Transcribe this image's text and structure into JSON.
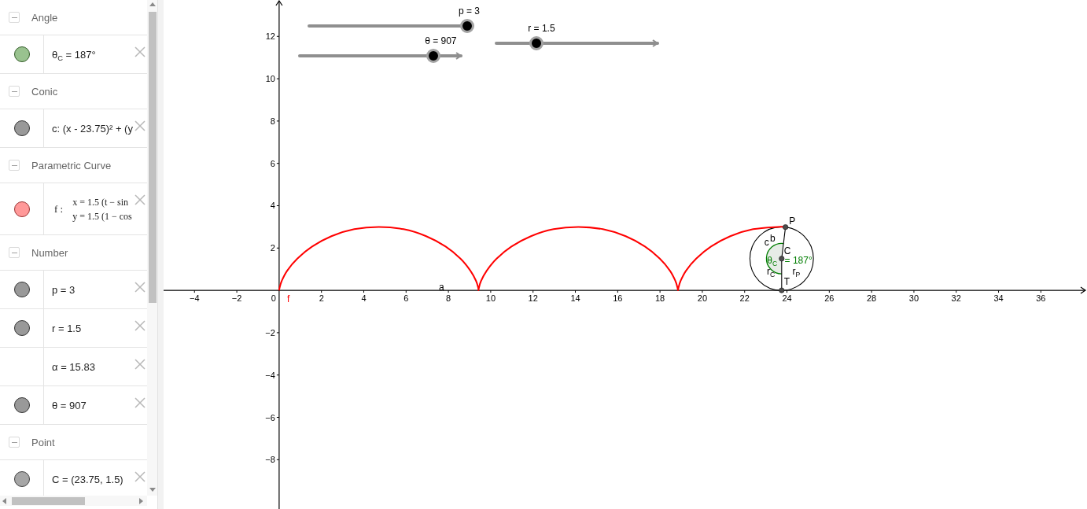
{
  "algebra": {
    "groups": [
      {
        "title": "Angle",
        "expanded": true,
        "items": [
          {
            "kind": "text",
            "color": "#99c28f",
            "text": "θ$_{C}$ = 187°"
          }
        ]
      },
      {
        "title": "Conic",
        "expanded": true,
        "items": [
          {
            "kind": "text",
            "color": "#999999",
            "text": "c: (x - 23.75)² + (y"
          }
        ]
      },
      {
        "title": "Parametric Curve",
        "expanded": true,
        "items": [
          {
            "kind": "parametric",
            "color": "#ff9999",
            "name": "f :",
            "lines": [
              "x = 1.5 (t − sin",
              "y = 1.5 (1 − cos"
            ]
          }
        ]
      },
      {
        "title": "Number",
        "expanded": true,
        "items": [
          {
            "kind": "text",
            "color": "#999999",
            "text": "p = 3"
          },
          {
            "kind": "text",
            "color": "#999999",
            "text": "r = 1.5"
          },
          {
            "kind": "text",
            "text": "α = 15.83"
          },
          {
            "kind": "text",
            "color": "#999999",
            "text": "θ = 907"
          }
        ]
      },
      {
        "title": "Point",
        "expanded": true,
        "items": [
          {
            "kind": "text",
            "color": "#a6a6a6",
            "text": "C = (23.75, 1.5)"
          }
        ]
      }
    ]
  },
  "graphics": {
    "origin_label": "0",
    "sliders": [
      {
        "label": "p = 3",
        "level": 0.98
      },
      {
        "label": "θ = 907",
        "level": 0.83
      },
      {
        "label": "r = 1.5",
        "level": 0.25
      }
    ],
    "labels": [
      {
        "text": "P"
      },
      {
        "text": "C"
      },
      {
        "text": "T"
      },
      {
        "text": "b"
      },
      {
        "text": "c"
      },
      {
        "text": "θ$_{C}$",
        "color": "#007d00"
      },
      {
        "text": "= 187°",
        "color": "#007d00"
      },
      {
        "text": "r$_{C}$"
      },
      {
        "text": "r$_{P}$"
      },
      {
        "text": "a"
      }
    ],
    "chart_data": {
      "type": "line",
      "x": [
        0,
        0.02,
        0.12,
        0.38,
        0.86,
        1.56,
        2.47,
        3.55,
        4.71,
        5.88,
        6.95,
        7.87,
        8.57,
        9.04,
        9.31,
        9.41,
        9.42,
        9.44,
        9.54,
        9.81,
        10.28,
        10.98,
        11.9,
        12.97,
        14.14,
        15.3,
        16.38,
        17.29,
        17.99,
        18.47,
        18.73,
        18.83,
        18.85,
        18.87,
        18.97,
        19.23,
        19.71,
        20.41,
        21.32,
        22.4,
        23.56,
        23.93
      ],
      "series": [
        {
          "name": "f",
          "color": "#ff0000",
          "values": [
            0,
            0.11,
            0.44,
            0.93,
            1.5,
            2.07,
            2.56,
            2.89,
            3,
            2.89,
            2.56,
            2.07,
            1.5,
            0.93,
            0.44,
            0.11,
            0,
            0.11,
            0.44,
            0.93,
            1.5,
            2.07,
            2.56,
            2.89,
            3,
            2.89,
            2.56,
            2.07,
            1.5,
            0.93,
            0.44,
            0.11,
            0,
            0.11,
            0.44,
            0.93,
            1.5,
            2.07,
            2.56,
            2.89,
            3,
            2.99
          ]
        }
      ],
      "xlim": [
        -5.46,
        38.18
      ],
      "ylim": [
        -10.33,
        13.72
      ],
      "xticks": [
        {
          "value": -4,
          "label": "−4"
        },
        {
          "value": -2,
          "label": "−2"
        },
        2,
        4,
        6,
        8,
        10,
        12,
        14,
        16,
        18,
        20,
        22,
        24,
        26,
        28,
        30,
        32,
        34,
        36
      ],
      "yticks": [
        {
          "value": -8,
          "label": "−8"
        },
        {
          "value": -6,
          "label": "−6"
        },
        {
          "value": -4,
          "label": "−4"
        },
        {
          "value": -2,
          "label": "−2"
        },
        2,
        4,
        6,
        8,
        10,
        12
      ]
    }
  }
}
